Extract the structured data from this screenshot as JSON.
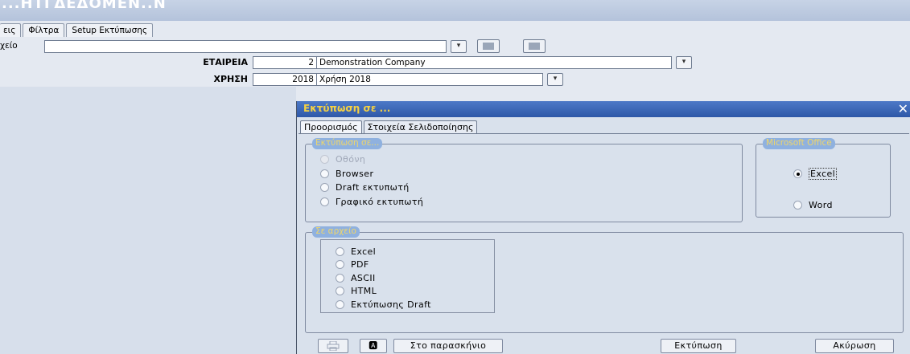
{
  "header": {
    "title": "...ΗΤΓΔΕΔΟΜΕΝ..Ν"
  },
  "main_tabs": [
    {
      "label": "εις"
    },
    {
      "label": "Φίλτρα"
    },
    {
      "label": "Setup Εκτύπωσης"
    }
  ],
  "form": {
    "file_label": "χείο",
    "file_value": "",
    "company_label": "ΕΤΑΙΡΕΙΑ",
    "company_code": "2",
    "company_name": "Demonstration Company",
    "year_label": "ΧΡΗΣΗ",
    "year_code": "2018",
    "year_name": "Χρήση 2018",
    "dropdown_glyph": "▾"
  },
  "dialog": {
    "title": "Εκτύπωση σε ...",
    "close_glyph": "✕",
    "tabs": [
      {
        "label": "Προορισμός"
      },
      {
        "label": "Στοιχεία Σελιδοποίησης"
      }
    ],
    "print_to": {
      "label": "Εκτύπωση σε...",
      "options": [
        {
          "label": "Οθόνη",
          "disabled": true,
          "checked": false
        },
        {
          "label": "Browser",
          "disabled": false,
          "checked": false
        },
        {
          "label": "Draft εκτυπωτή",
          "disabled": false,
          "checked": false
        },
        {
          "label": "Γραφικό εκτυπωτή",
          "disabled": false,
          "checked": false
        }
      ]
    },
    "office": {
      "label": "Microsoft Office",
      "options": [
        {
          "label": "Excel",
          "checked": true
        },
        {
          "label": "Word",
          "checked": false
        }
      ]
    },
    "to_file": {
      "label": "Σε αρχείο",
      "options": [
        {
          "label": "Excel"
        },
        {
          "label": "PDF"
        },
        {
          "label": "ASCII"
        },
        {
          "label": "HTML"
        },
        {
          "label": "Εκτύπωσης Draft"
        }
      ]
    },
    "footer": {
      "printer_icon": "printer-icon",
      "preview_glyph": "🅰",
      "background_label": "Στο παρασκήνιο",
      "print_label": "Εκτύπωση",
      "cancel_label": "Ακύρωση"
    }
  },
  "colors": {
    "title_bar": "#2e58a8",
    "dialog_title_text": "#f5d142",
    "group_label_bg": "#8fb1df"
  }
}
